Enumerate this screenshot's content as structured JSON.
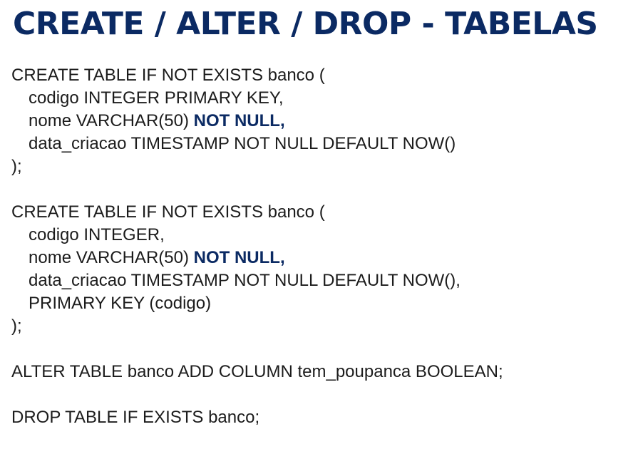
{
  "title": "CREATE / ALTER / DROP - TABELAS",
  "block1": {
    "l1": "CREATE TABLE IF NOT EXISTS banco (",
    "l2": "codigo INTEGER PRIMARY KEY,",
    "l3_prefix": "nome VARCHAR(50) ",
    "l3_bold": "NOT NULL,",
    "l4": "data_criacao TIMESTAMP NOT NULL DEFAULT NOW()",
    "l5": ");"
  },
  "block2": {
    "l1": "CREATE TABLE IF NOT EXISTS banco (",
    "l2": "codigo INTEGER,",
    "l3_prefix": "nome VARCHAR(50) ",
    "l3_bold": "NOT NULL,",
    "l4": "data_criacao TIMESTAMP NOT NULL DEFAULT NOW(),",
    "l5": "PRIMARY KEY (codigo)",
    "l6": ");"
  },
  "alter_line": "ALTER TABLE banco ADD COLUMN tem_poupanca BOOLEAN;",
  "drop_line": "DROP TABLE IF EXISTS banco;",
  "colors": {
    "title": "#0b2a63",
    "text": "#1c1c1c",
    "background": "#ffffff"
  }
}
